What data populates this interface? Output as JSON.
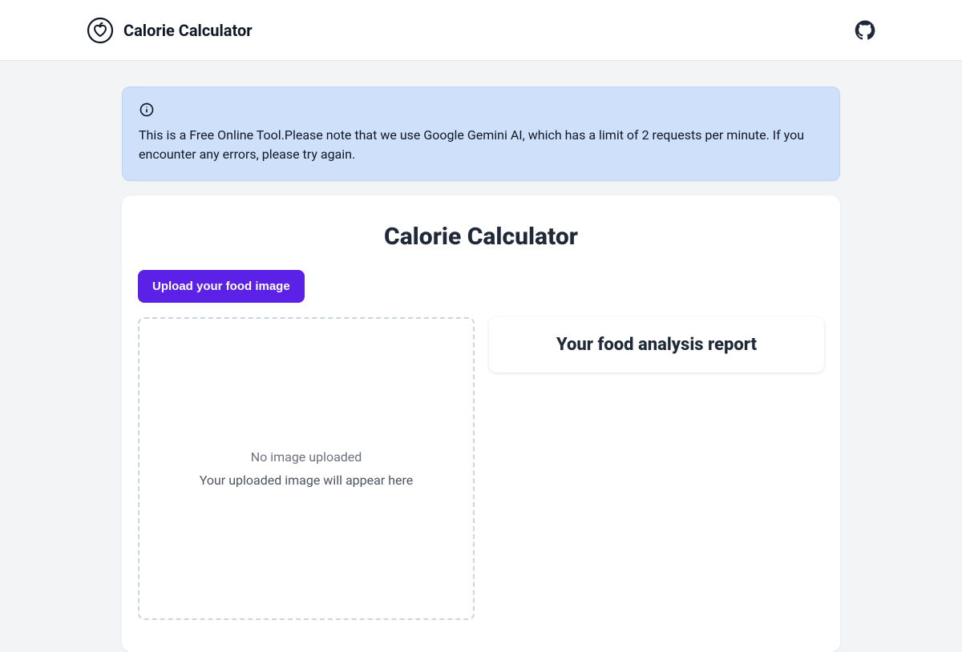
{
  "header": {
    "title": "Calorie Calculator"
  },
  "alert": {
    "text": "This is a Free Online Tool.Please note that we use Google Gemini AI, which has a limit of 2 requests per minute. If you encounter any errors, please try again."
  },
  "main": {
    "title": "Calorie Calculator",
    "upload_button_label": "Upload your food image",
    "dropzone": {
      "line1": "No image uploaded",
      "line2": "Your uploaded image will appear here"
    },
    "report_title": "Your food analysis report"
  },
  "colors": {
    "accent": "#5b21e6",
    "alert_bg": "#cee0fa"
  }
}
